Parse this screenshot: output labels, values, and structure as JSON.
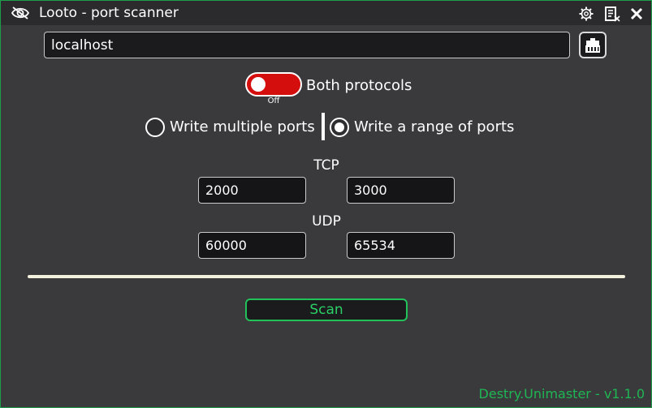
{
  "window": {
    "title": "Looto - port scanner",
    "accent_color": "#1e9e4a"
  },
  "titlebar": {
    "icons": [
      "eye-icon",
      "settings-icon",
      "notes-icon",
      "close-icon"
    ]
  },
  "host": {
    "value": "localhost"
  },
  "network_button": {
    "icon": "network-icon"
  },
  "protocol_toggle": {
    "label": "Both protocols",
    "state_text": "Off",
    "color_off": "#d40d0d"
  },
  "mode": {
    "options": [
      {
        "label": "Write multiple ports",
        "selected": false
      },
      {
        "label": "Write a range of ports",
        "selected": true
      }
    ]
  },
  "tcp": {
    "label": "TCP",
    "from": "2000",
    "to": "3000"
  },
  "udp": {
    "label": "UDP",
    "from": "60000",
    "to": "65534"
  },
  "progress": {
    "value": 1.0
  },
  "scan": {
    "label": "Scan",
    "color": "#21c25a"
  },
  "footer": {
    "version": "Destry.Unimaster - v1.1.0"
  }
}
